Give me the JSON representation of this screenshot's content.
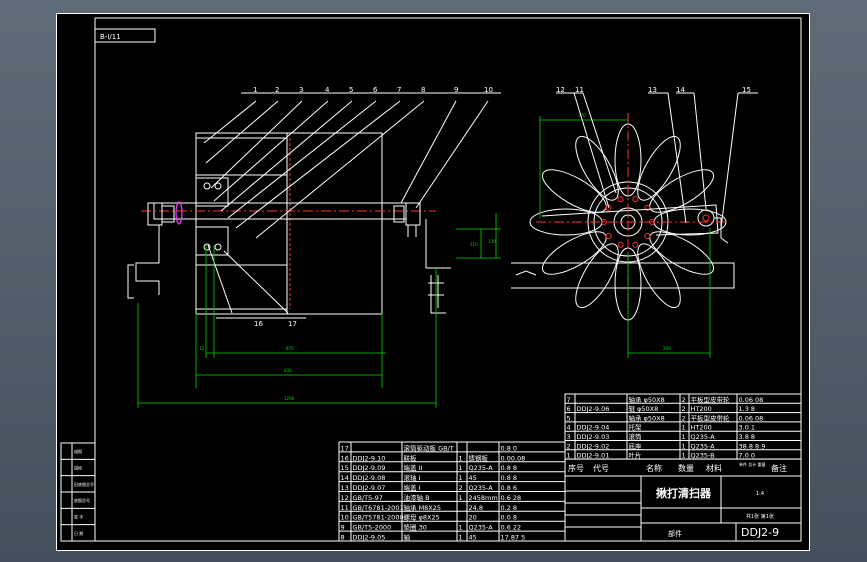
{
  "drawing": {
    "sheet_tag": "B-I/11",
    "balloons_left": [
      "1",
      "2",
      "3",
      "4",
      "5",
      "6",
      "7",
      "8",
      "9",
      "10"
    ],
    "balloons_left_bottom": [
      "16",
      "17"
    ],
    "balloons_right": [
      "12",
      "11",
      "13",
      "14",
      "15"
    ],
    "dims": {
      "d_top": "170",
      "d_right": "200",
      "d_vert_a": "110",
      "d_vert_b": "130",
      "d_12": "12",
      "d_870": "870",
      "d_930": "930",
      "d_1200": "1200"
    }
  },
  "bom_left": [
    {
      "no": "17",
      "code": "",
      "name": "滚筒驱动板 GB/T",
      "qty": "",
      "mat": "",
      "note": "0.8 0"
    },
    {
      "no": "16",
      "code": "DDJ2-9.10",
      "name": "联板",
      "qty": "1",
      "mat": "铸钢板",
      "note": "0.00.08"
    },
    {
      "no": "15",
      "code": "DDJ2-9.09",
      "name": "端盖 II",
      "qty": "1",
      "mat": "Q235-A",
      "note": "0.8 8"
    },
    {
      "no": "14",
      "code": "DDJ2-9.08",
      "name": "滚轴 I",
      "qty": "1",
      "mat": "45",
      "note": "0.8 8"
    },
    {
      "no": "13",
      "code": "DDJ2-9.07",
      "name": "端盖 I",
      "qty": "2",
      "mat": "Q235-A",
      "note": "0.8 6"
    },
    {
      "no": "12",
      "code": "GB/T5-97",
      "name": "油漆轴 B",
      "qty": "1",
      "mat": "2458mm",
      "note": "0.6 28"
    },
    {
      "no": "11",
      "code": "GB/T6781-2001",
      "name": "轴承 M8X25",
      "qty": "",
      "mat": "24.8",
      "note": "0.2 8"
    },
    {
      "no": "10",
      "code": "GB/T5781-2000",
      "name": "螺母 φ8X25",
      "qty": "",
      "mat": "20",
      "note": "0.0 8"
    },
    {
      "no": "9",
      "code": "GB/T5-2000",
      "name": "垫圈 30",
      "qty": "1",
      "mat": "Q235-A",
      "note": "0.6 22"
    },
    {
      "no": "8",
      "code": "DDJ2-9.05",
      "name": "轴",
      "qty": "1",
      "mat": "45",
      "note": "17.87 5"
    }
  ],
  "bom_right": [
    {
      "no": "7",
      "code": "",
      "name": "轴承 φ50X8",
      "qty": "2",
      "mat": "平板型皮带轮",
      "note": "0.06 08"
    },
    {
      "no": "6",
      "code": "DDJ2-9.06",
      "name": "辊 φ50X8",
      "qty": "2",
      "mat": "HT200",
      "note": "1.3 8"
    },
    {
      "no": "5",
      "code": "",
      "name": "轴承 φ50X8",
      "qty": "2",
      "mat": "平板型皮带轮",
      "note": "0.06 08"
    },
    {
      "no": "4",
      "code": "DDJ2-9.04",
      "name": "托架",
      "qty": "1",
      "mat": "HT200",
      "note": "3.0 1"
    },
    {
      "no": "3",
      "code": "DDJ2-9.03",
      "name": "滚筒",
      "qty": "1",
      "mat": "Q235-A",
      "note": "3.8 8"
    },
    {
      "no": "2",
      "code": "DDJ2-9.02",
      "name": "底座",
      "qty": "1",
      "mat": "Q235-A",
      "note": "38.8 8.9"
    },
    {
      "no": "1",
      "code": "DDJ2-9.01",
      "name": "叶片",
      "qty": "1",
      "mat": "Q235-B",
      "note": "7.0 0"
    }
  ],
  "bom_header": {
    "no": "序号",
    "code": "代号",
    "name": "名称",
    "qty": "数量",
    "mat": "材料",
    "weight": "单件 总计 重量",
    "note": "备注"
  },
  "title_block": {
    "title": "揪打清扫器",
    "unit": "部件",
    "drawing_no": "DDJ2-9",
    "scale_label": "1:4",
    "sheet": "共1张 第1张"
  },
  "side_strip": [
    "描图",
    "描校",
    "旧底图总号",
    "底图总号",
    "签 字",
    "日 期"
  ]
}
